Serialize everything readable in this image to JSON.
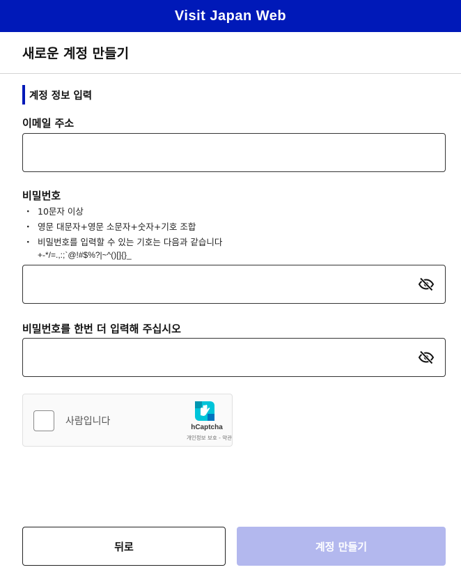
{
  "app": {
    "title": "Visit Japan Web",
    "brand_color": "#0019b8"
  },
  "page": {
    "title": "새로운 계정 만들기"
  },
  "section": {
    "heading": "계정 정보 입력"
  },
  "email": {
    "label": "이메일 주소",
    "value": "",
    "placeholder": ""
  },
  "password": {
    "label": "비밀번호",
    "value": "",
    "hints": [
      "10문자 이상",
      "영문 대문자+영문 소문자+숫자+기호 조합",
      "비밀번호를 입력할 수 있는 기호는 다음과 같습니다"
    ],
    "symbols": "+-*/=.,:;`@!#$%?|~^()[]{}_",
    "toggle_icon": "eye-off-icon"
  },
  "password_confirm": {
    "label": "비밀번호를 한번 더 입력해 주십시오",
    "value": "",
    "toggle_icon": "eye-off-icon"
  },
  "captcha": {
    "label": "사람입니다",
    "brand": "hCaptcha",
    "links": "개인정보 보호 - 약관",
    "checked": false
  },
  "buttons": {
    "back": "뒤로",
    "create": "계정 만들기",
    "create_disabled": true,
    "create_color": "#b3b8ee"
  },
  "bullet": "・"
}
